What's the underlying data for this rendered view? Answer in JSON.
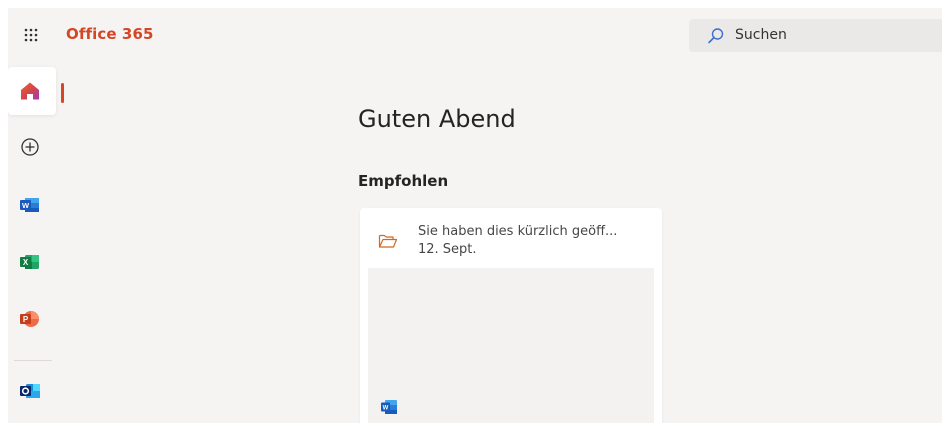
{
  "header": {
    "app_title": "Office 365",
    "search": {
      "placeholder": "Suchen"
    }
  },
  "rail": {
    "items": [
      {
        "name": "home",
        "icon": "home-icon",
        "active": true
      },
      {
        "name": "create",
        "icon": "add-circle-icon"
      },
      {
        "name": "word",
        "icon": "word-icon"
      },
      {
        "name": "excel",
        "icon": "excel-icon"
      },
      {
        "name": "powerpoint",
        "icon": "powerpoint-icon"
      },
      {
        "name": "outlook",
        "icon": "outlook-icon"
      }
    ]
  },
  "main": {
    "greeting": "Guten Abend",
    "recommended": {
      "title": "Empfohlen",
      "cards": [
        {
          "activity": "Sie haben dies kürzlich geöff...",
          "date": "12. Sept.",
          "icon": "folder-open-icon",
          "file_icon": "word-icon"
        }
      ]
    }
  },
  "colors": {
    "brand": "#d24726",
    "background": "#f6f4f3",
    "search_bg": "#ebe9e8"
  }
}
